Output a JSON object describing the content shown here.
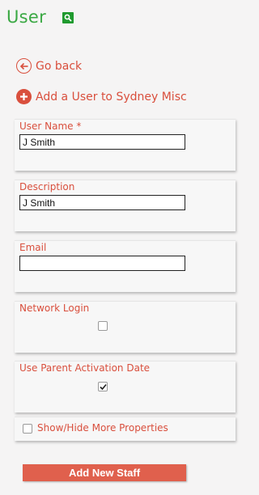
{
  "header": {
    "title": "User",
    "search_icon": "search-icon"
  },
  "nav": {
    "go_back": "Go back",
    "add_user": "Add a User to Sydney Misc"
  },
  "form": {
    "user_name": {
      "label": "User Name *",
      "value": "J Smith"
    },
    "description": {
      "label": "Description",
      "value": "J Smith"
    },
    "email": {
      "label": "Email",
      "value": ""
    },
    "network_login": {
      "label": "Network Login",
      "checked": false
    },
    "use_parent_activation_date": {
      "label": "Use Parent Activation Date",
      "checked": true
    },
    "show_hide_more": {
      "label": "Show/Hide More Properties",
      "checked": false
    }
  },
  "submit_label": "Add New Staff",
  "colors": {
    "accent": "#d94f3d",
    "title_green": "#3aa843",
    "button": "#e0604d"
  }
}
